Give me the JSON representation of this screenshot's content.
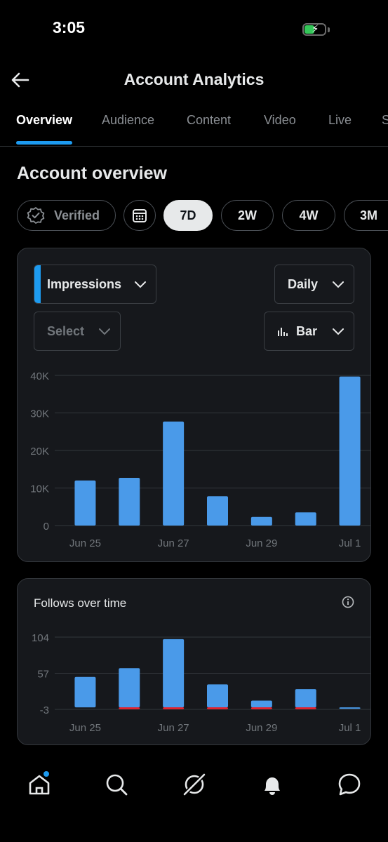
{
  "status_bar": {
    "time": "3:05"
  },
  "header": {
    "title": "Account Analytics"
  },
  "tabs": [
    {
      "label": "Overview",
      "active": true
    },
    {
      "label": "Audience"
    },
    {
      "label": "Content"
    },
    {
      "label": "Video"
    },
    {
      "label": "Live"
    },
    {
      "label": "S"
    }
  ],
  "section": {
    "title": "Account overview"
  },
  "filters": {
    "verified_label": "Verified",
    "ranges": [
      "7D",
      "2W",
      "4W",
      "3M"
    ],
    "selected_range": "7D"
  },
  "impressions_card": {
    "metric_label": "Impressions",
    "interval_label": "Daily",
    "compare_placeholder": "Select",
    "chart_type_label": "Bar"
  },
  "follows_card": {
    "title": "Follows over time"
  },
  "colors": {
    "accent": "#1d9bf0",
    "bar": "#4a9ae9",
    "negative": "#f4212e"
  },
  "chart_data": [
    {
      "type": "bar",
      "categories": [
        "Jun 25",
        "Jun 26",
        "Jun 27",
        "Jun 28",
        "Jun 29",
        "Jun 30",
        "Jul 1"
      ],
      "x_tick_labels": [
        "Jun 25",
        "Jun 27",
        "Jun 29",
        "Jul 1"
      ],
      "y_tick_labels": [
        "40K",
        "30K",
        "20K",
        "10K",
        "0"
      ],
      "values": [
        12000,
        12700,
        27700,
        7800,
        2300,
        3500,
        39700
      ],
      "ylim": [
        0,
        40000
      ],
      "grid": true
    },
    {
      "type": "bar",
      "categories": [
        "Jun 25",
        "Jun 26",
        "Jun 27",
        "Jun 28",
        "Jun 29",
        "Jun 30",
        "Jul 1"
      ],
      "x_tick_labels": [
        "Jun 25",
        "Jun 27",
        "Jun 29",
        "Jul 1"
      ],
      "y_tick_labels": [
        "104",
        "57",
        "-3"
      ],
      "series": [
        {
          "values": [
            45,
            58,
            101,
            34,
            10,
            27,
            0
          ]
        },
        {
          "values": [
            0,
            -2,
            -1,
            -2,
            -1,
            -1,
            0
          ]
        }
      ],
      "ylim": [
        -3,
        104
      ],
      "grid": true
    }
  ]
}
